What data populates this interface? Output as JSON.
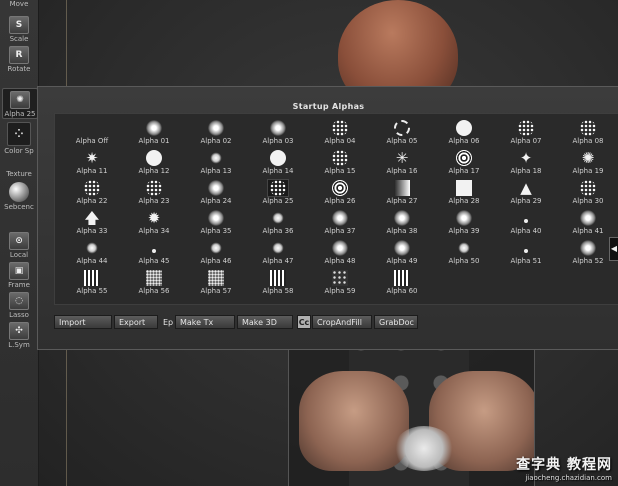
{
  "toolbar": {
    "items": [
      {
        "label": "Move",
        "icon": "move-icon",
        "glyph": ""
      },
      {
        "label": "Scale",
        "icon": "scale-icon",
        "glyph": "S"
      },
      {
        "label": "Rotate",
        "icon": "rotate-icon",
        "glyph": "R"
      },
      {
        "label": "Alpha 25",
        "icon": "alpha-icon",
        "glyph": "✺"
      },
      {
        "label": "Color Sp",
        "icon": "color-spray-icon",
        "glyph": "⁘"
      },
      {
        "label": "Texture",
        "icon": "texture-icon",
        "glyph": ""
      },
      {
        "label": "Sebcenc",
        "icon": "material-sphere-icon",
        "glyph": ""
      },
      {
        "label": "Local",
        "icon": "local-icon",
        "glyph": "⊙"
      },
      {
        "label": "Frame",
        "icon": "frame-icon",
        "glyph": "▣"
      },
      {
        "label": "Lasso",
        "icon": "lasso-icon",
        "glyph": "◌"
      },
      {
        "label": "L.Sym",
        "icon": "symmetry-icon",
        "glyph": "✣"
      }
    ]
  },
  "palette": {
    "title": "Startup Alphas",
    "alphas": [
      {
        "label": "Alpha Off",
        "shape": "none"
      },
      {
        "label": "Alpha 01",
        "shape": "soft"
      },
      {
        "label": "Alpha 02",
        "shape": "soft"
      },
      {
        "label": "Alpha 03",
        "shape": "soft"
      },
      {
        "label": "Alpha 04",
        "shape": "dots"
      },
      {
        "label": "Alpha 05",
        "shape": "ring"
      },
      {
        "label": "Alpha 06",
        "shape": "solid"
      },
      {
        "label": "Alpha 07",
        "shape": "dots"
      },
      {
        "label": "Alpha 08",
        "shape": "dots"
      },
      {
        "label": "Alpha 11",
        "shape": "star",
        "glyph": "✷"
      },
      {
        "label": "Alpha 12",
        "shape": "solid"
      },
      {
        "label": "Alpha 13",
        "shape": "small"
      },
      {
        "label": "Alpha 14",
        "shape": "solid"
      },
      {
        "label": "Alpha 15",
        "shape": "dots"
      },
      {
        "label": "Alpha 16",
        "shape": "star",
        "glyph": "✳"
      },
      {
        "label": "Alpha 17",
        "shape": "rings"
      },
      {
        "label": "Alpha 18",
        "shape": "star",
        "glyph": "✦"
      },
      {
        "label": "Alpha 19",
        "shape": "star",
        "glyph": "✺"
      },
      {
        "label": "Alpha 22",
        "shape": "dots"
      },
      {
        "label": "Alpha 23",
        "shape": "dots"
      },
      {
        "label": "Alpha 24",
        "shape": "soft"
      },
      {
        "label": "Alpha 25",
        "shape": "dots"
      },
      {
        "label": "Alpha 26",
        "shape": "rings"
      },
      {
        "label": "Alpha 27",
        "shape": "grad"
      },
      {
        "label": "Alpha 28",
        "shape": "square"
      },
      {
        "label": "Alpha 29",
        "shape": "star",
        "glyph": "▲"
      },
      {
        "label": "Alpha 30",
        "shape": "dots"
      },
      {
        "label": "Alpha 33",
        "shape": "star",
        "glyph": "🡅"
      },
      {
        "label": "Alpha 34",
        "shape": "star",
        "glyph": "✹"
      },
      {
        "label": "Alpha 35",
        "shape": "soft"
      },
      {
        "label": "Alpha 36",
        "shape": "small"
      },
      {
        "label": "Alpha 37",
        "shape": "soft"
      },
      {
        "label": "Alpha 38",
        "shape": "soft"
      },
      {
        "label": "Alpha 39",
        "shape": "soft"
      },
      {
        "label": "Alpha 40",
        "shape": "tiny"
      },
      {
        "label": "Alpha 41",
        "shape": "soft"
      },
      {
        "label": "Alpha 44",
        "shape": "small"
      },
      {
        "label": "Alpha 45",
        "shape": "tiny"
      },
      {
        "label": "Alpha 46",
        "shape": "small"
      },
      {
        "label": "Alpha 47",
        "shape": "small"
      },
      {
        "label": "Alpha 48",
        "shape": "soft"
      },
      {
        "label": "Alpha 49",
        "shape": "soft"
      },
      {
        "label": "Alpha 50",
        "shape": "small"
      },
      {
        "label": "Alpha 51",
        "shape": "tiny"
      },
      {
        "label": "Alpha 52",
        "shape": "soft"
      },
      {
        "label": "Alpha 55",
        "shape": "stripes"
      },
      {
        "label": "Alpha 56",
        "shape": "noise"
      },
      {
        "label": "Alpha 57",
        "shape": "noise"
      },
      {
        "label": "Alpha 58",
        "shape": "stripes"
      },
      {
        "label": "Alpha 59",
        "shape": "cells"
      },
      {
        "label": "Alpha 60",
        "shape": "stripes"
      }
    ],
    "selected_alpha": "Alpha 25",
    "buttons": {
      "import": "Import",
      "export": "Export",
      "ep": "Ep",
      "make_tx": "Make Tx",
      "make_3d": "Make 3D",
      "cc": "Cc",
      "crop_and_fill": "CropAndFill",
      "grab_doc": "GrabDoc"
    }
  },
  "watermark": {
    "title": "查字典 教程网",
    "url": "jiaocheng.chazidian.com"
  }
}
